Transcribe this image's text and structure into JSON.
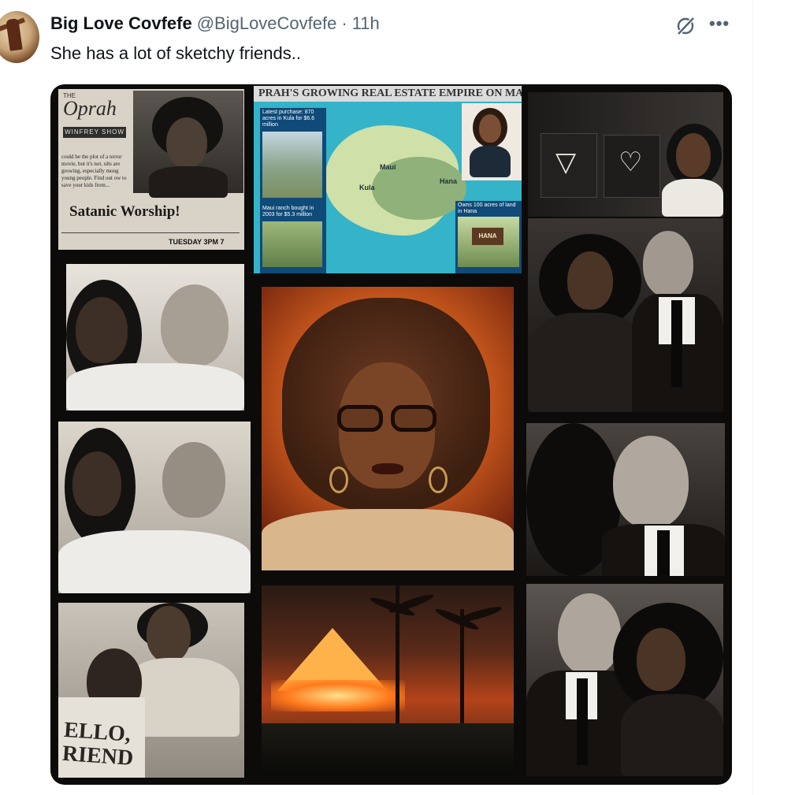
{
  "tweet": {
    "display_name": "Big Love Covfefe",
    "handle": "@BigLoveCovfefe",
    "separator": "·",
    "time": "11h",
    "text": "She has a lot of sketchy friends..",
    "grok_icon": "grok-icon",
    "more_icon": "more-icon",
    "more_label": "•••"
  },
  "media": {
    "clipping": {
      "the": "THE",
      "logo": "Oprah",
      "show": "WINFREY SHOW",
      "blurb": "could be the plot of a terror movie, but it's not. ults are growing, especially mong young people. Find out ow to save your kids from...",
      "headline": "Satanic Worship!",
      "airtime": "TUESDAY 3PM 7"
    },
    "map": {
      "banner": "PRAH'S GROWING REAL ESTATE EMPIRE ON MAUI",
      "latest": "Latest purchase: 870 acres in Kula for $6.6 million",
      "ranch": "Maui ranch bought in 2003 for $5.3 million",
      "hana": "Owns 100 acres of land in Hana",
      "label_maui": "Maui",
      "label_kula": "Kula",
      "label_hana": "Hana",
      "sign": "HANA"
    },
    "shirt_text": "ELLO,\nRIEND"
  },
  "colors": {
    "text_primary": "#0f1419",
    "text_secondary": "#536471",
    "map_box": "#0f4a78"
  }
}
